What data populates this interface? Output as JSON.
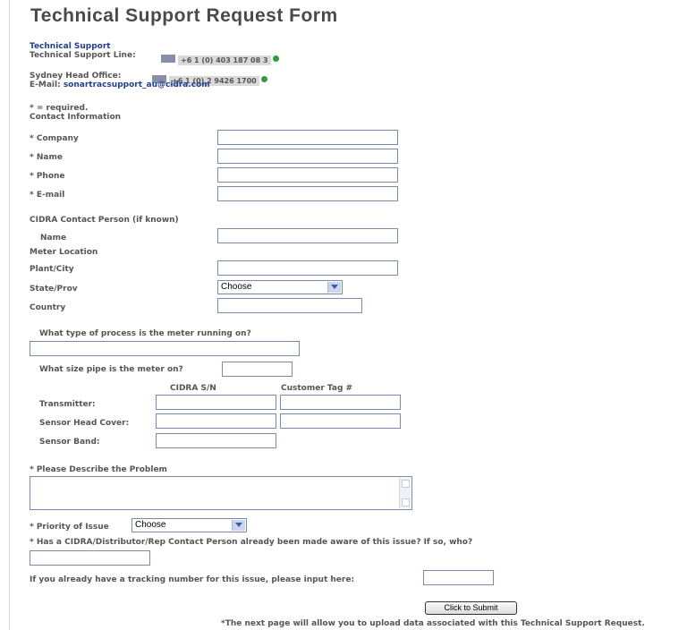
{
  "title": "Technical Support Request Form",
  "contact": {
    "heading": "Technical Support",
    "support_line_label": "Technical Support Line:",
    "support_line_phone": "+6 1 (0) 403 187 08 3",
    "office_label": "Sydney Head Office:",
    "office_phone": "+6 1 (0) 2 9426 1700",
    "email_label": "E-Mail:",
    "email": "sonartracsupport_au@cidra.com"
  },
  "required_note": "* = required.",
  "contact_info_heading": "Contact Information",
  "fields": {
    "company": "* Company",
    "name": "* Name",
    "phone": "* Phone",
    "email": "* E-mail"
  },
  "cidra_contact_heading": "CIDRA Contact Person (if known)",
  "cidra_name_label": "Name",
  "meter_location_heading": "Meter Location",
  "plant_city_label": "Plant/City",
  "state_label": "State/Prov",
  "state_select": "Choose",
  "country_label": "Country",
  "process_question": "What type of process is the meter running on?",
  "pipe_question": "What size pipe is the meter on?",
  "serial_header": "CIDRA S/N",
  "tag_header": "Customer Tag #",
  "transmitter_label": "Transmitter:",
  "sensor_head_label": "Sensor Head Cover:",
  "sensor_band_label": "Sensor Band:",
  "problem_label": "* Please Describe the Problem",
  "priority_label": "* Priority of Issue",
  "priority_select": "Choose",
  "aware_question": "* Has a CIDRA/Distributor/Rep Contact Person already been made aware of this issue? If so, who?",
  "tracking_question": "If you already have a tracking number for this issue, please input here:",
  "submit_label": "Click to Submit",
  "footer_note": "*The next page will allow you to upload data associated with this Technical Support Request."
}
